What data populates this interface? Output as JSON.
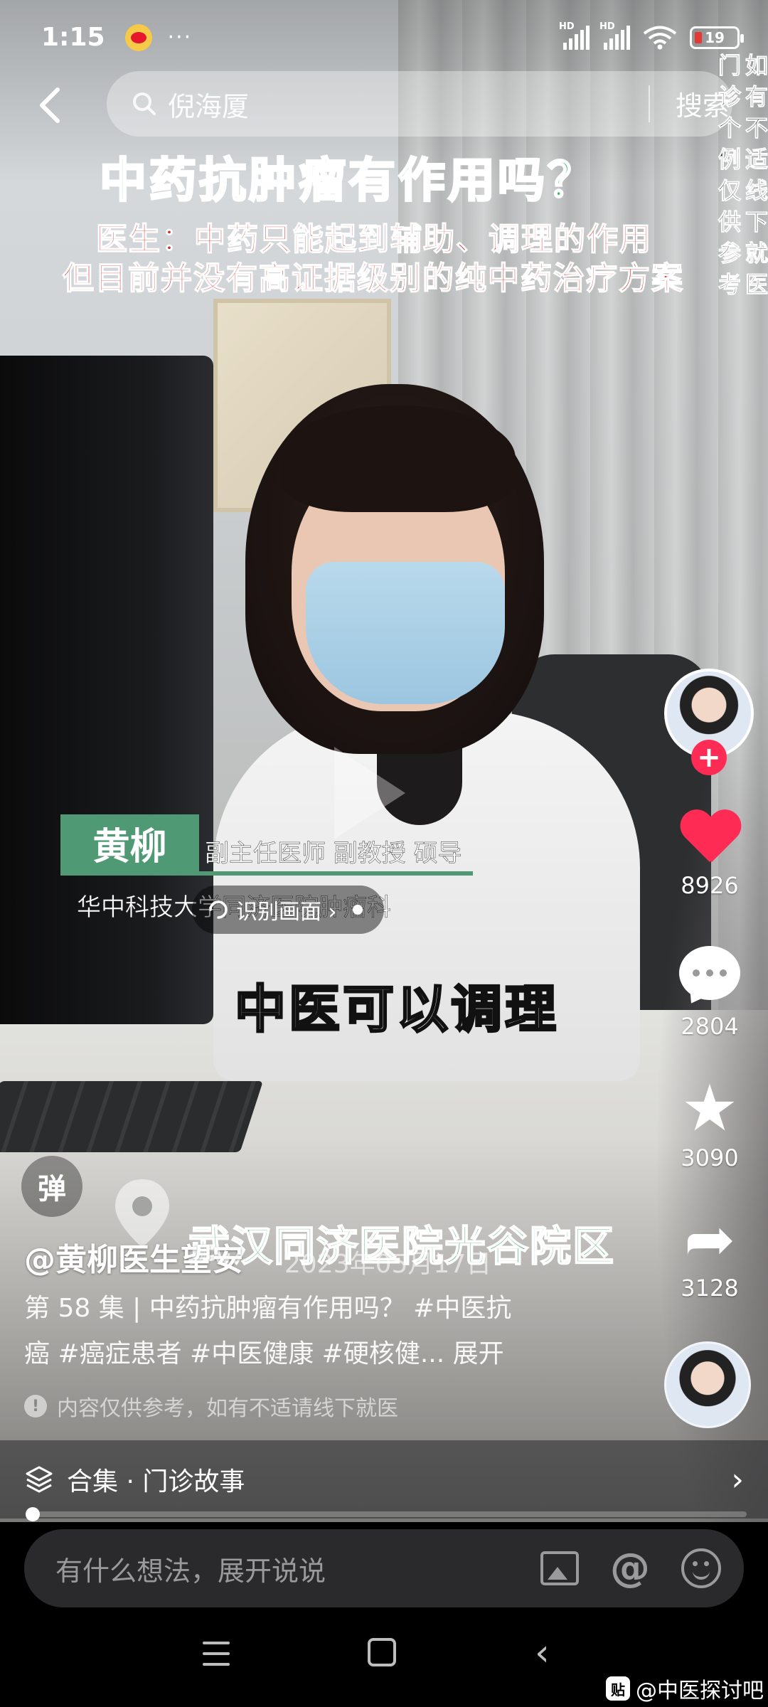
{
  "status_bar": {
    "time": "1:15",
    "more": "···",
    "signal1": "HD",
    "signal2": "HD",
    "battery": "19",
    "icons": [
      "weibo-icon",
      "signal-icon",
      "wifi-icon",
      "battery-icon"
    ]
  },
  "search": {
    "query": "倪海厦",
    "button": "搜索"
  },
  "video": {
    "title_question": "中药抗肿瘤有作用吗？",
    "subtitle_line1": "医生：中药只能起到辅助、调理的作用",
    "subtitle_line2": "但目前并没有高证据级别的纯中药治疗方案",
    "vertical_col1": "门诊个例仅供参考",
    "vertical_col2": "如有不适线下就医",
    "doctor_name": "黄柳",
    "doctor_title": "副主任医师 副教授 硕导",
    "doctor_hospital": "华中科技大学同济医院肿瘤科",
    "recognize_label": "识别画面 ›",
    "caption_main": "中医可以调理",
    "caption_location": "武汉同济医院光谷院区"
  },
  "rail": {
    "likes": "8926",
    "comments": "2804",
    "favorites": "3090",
    "shares": "3128",
    "follow_plus": "+"
  },
  "info": {
    "danmu": "弹",
    "author": "@黄柳医生望安",
    "date": "2023年05月17日",
    "description_line1": "第 58 集 | 中药抗肿瘤有作用吗？ #中医抗",
    "description_line2": "癌 #癌症患者 #中医健康 #硬核健... 展开",
    "notice": "内容仅供参考，如有不适请线下就医",
    "notice_icon": "!"
  },
  "collection": {
    "label": "合集 · 门诊故事"
  },
  "progress": {
    "value": 0.0
  },
  "comment": {
    "placeholder": "有什么想法，展开说说"
  },
  "watermark": {
    "badge": "贴",
    "text": "@中医探讨吧"
  },
  "colors": {
    "accent_red": "#fe2c55",
    "caption_green": "#3bb86b",
    "caption_red": "#d0302e",
    "name_tag_green": "#4f9a74"
  }
}
